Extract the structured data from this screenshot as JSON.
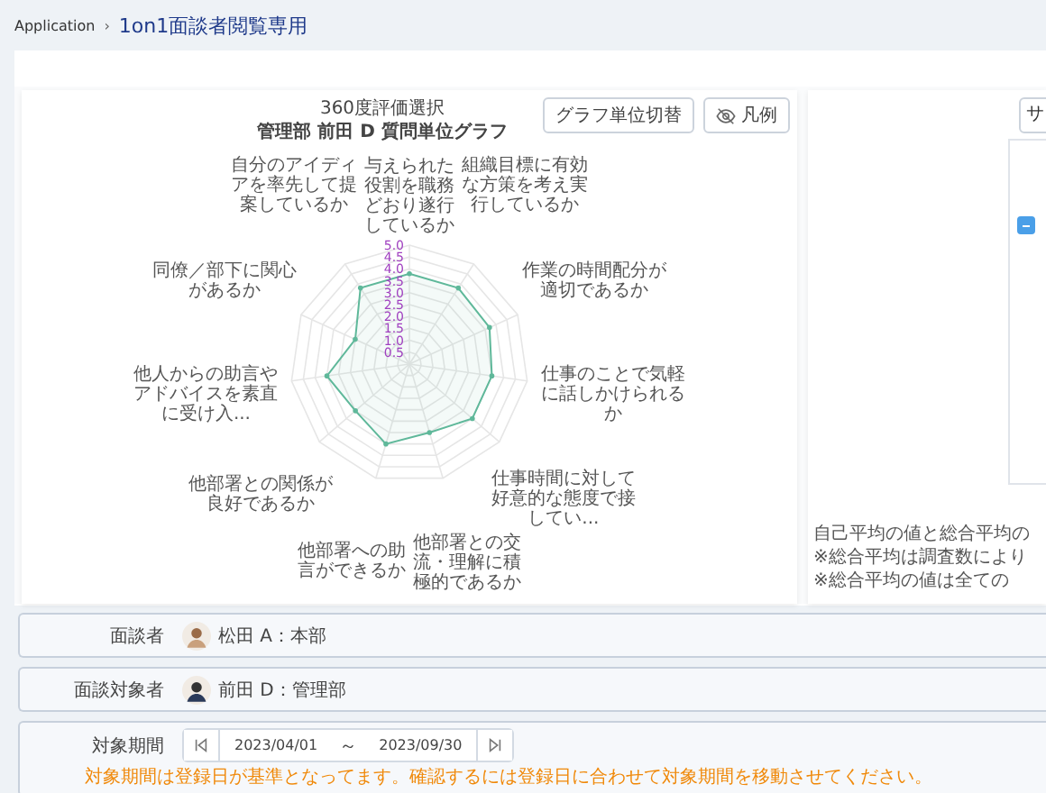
{
  "breadcrumb": {
    "root": "Application",
    "separator": "›",
    "current": "1on1面談者閲覧専用"
  },
  "chart_panel": {
    "buttons": [
      {
        "label": "グラフ単位切替",
        "kind": "text"
      },
      {
        "label": "凡例",
        "kind": "legend"
      }
    ],
    "subtitle": "管理部 前田 D 質問単位グラフ",
    "chart_data": {
      "type": "radar",
      "title": "360度評価選択",
      "categories": [
        "与えられた役割を職務どおり遂行しているか",
        "組織目標に有効な方策を考え実行しているか",
        "作業の時間配分が適切であるか",
        "仕事のことで気軽に話しかけられるか",
        "仕事時間に対して好意的な態度で接してい...",
        "他部署との交流・理解に積極的であるか",
        "他部署への助言ができるか",
        "他部署との関係が良好であるか",
        "他人からの助言やアドバイスを素直に受け入...",
        "同僚／部下に関心があるか",
        "自分のアイディアを率先して提案しているか"
      ],
      "ylim": [
        0,
        5
      ],
      "yticks": [
        {
          "value": 0.5,
          "label": "0.5"
        },
        {
          "value": 1,
          "label": "1.0"
        },
        {
          "value": 1.5,
          "label": "1.5"
        },
        {
          "value": 2,
          "label": "2.0"
        },
        {
          "value": 2.5,
          "label": "2.5"
        },
        {
          "value": 3,
          "label": "3.0"
        },
        {
          "value": 3.5,
          "label": "3.5"
        },
        {
          "value": 4,
          "label": "4.0"
        },
        {
          "value": 4.5,
          "label": "4.5"
        },
        {
          "value": 5,
          "label": "5.0"
        }
      ],
      "series": [
        {
          "color": "#5fb89a",
          "values": [
            3.8,
            3.8,
            3.7,
            3.5,
            3.5,
            3.0,
            3.5,
            3.0,
            3.5,
            2.5,
            3.8
          ]
        }
      ]
    }
  },
  "side_panel": {
    "select_text": "サ",
    "checkbox": {
      "indeterminate": true
    },
    "notes": [
      "自己平均の値と総合平均の",
      "※総合平均は調査数により",
      "※総合平均の値は全ての"
    ]
  },
  "fields": [
    {
      "kind": "person",
      "label": "面談者",
      "value": "松田 A：本部"
    },
    {
      "kind": "person",
      "label": "面談対象者",
      "value": "前田 D：管理部"
    },
    {
      "kind": "period",
      "label": "対象期間",
      "start": "2023/04/01",
      "separator": "～",
      "end": "2023/09/30",
      "warning": "対象期間は登録日が基準となってます。確認するには登録日に合わせて対象期間を移動させてください。"
    }
  ]
}
